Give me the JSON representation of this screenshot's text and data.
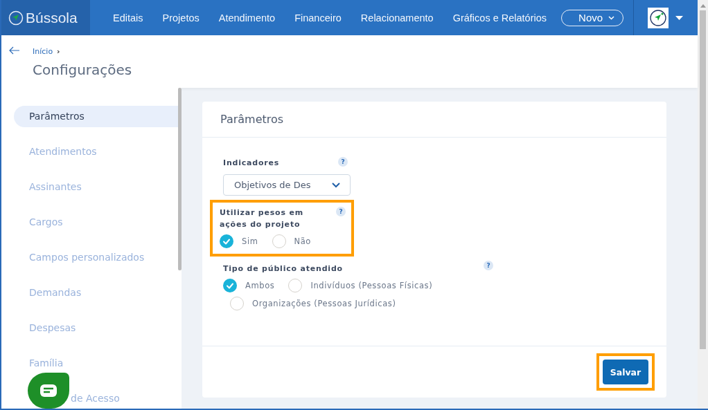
{
  "brand": {
    "name": "Bússola"
  },
  "nav": [
    {
      "label": "Editais"
    },
    {
      "label": "Projetos"
    },
    {
      "label": "Atendimento"
    },
    {
      "label": "Financeiro"
    },
    {
      "label": "Relacionamento"
    },
    {
      "label": "Gráficos e Relatórios"
    }
  ],
  "new_button": {
    "label": "Novo"
  },
  "breadcrumb": [
    {
      "label": "Início",
      "separator": "›"
    }
  ],
  "page_title": "Configurações",
  "sidebar": {
    "items": [
      {
        "label": "Parâmetros",
        "selected": true,
        "covered_start": false
      },
      {
        "label": "Atendimentos",
        "selected": false,
        "covered_start": false
      },
      {
        "label": "Assinantes",
        "selected": false,
        "covered_start": false
      },
      {
        "label": "Cargos",
        "selected": false,
        "covered_start": false
      },
      {
        "label": "Campos personalizados",
        "selected": false,
        "covered_start": false
      },
      {
        "label": "Demandas",
        "selected": false,
        "covered_start": false
      },
      {
        "label": "Despesas",
        "selected": false,
        "covered_start": false
      },
      {
        "label": "Família",
        "selected": false,
        "covered_start": false
      },
      {
        "label": "de Acesso",
        "selected": false,
        "covered_start": true
      }
    ]
  },
  "card": {
    "title": "Parâmetros",
    "fields": [
      {
        "kind": "select",
        "label": "Indicadores",
        "help": "?",
        "value": "Objetivos de Des",
        "highlighted": false
      },
      {
        "kind": "radio",
        "label": "Utilizar pesos em ações do projeto",
        "help": "?",
        "highlighted": true,
        "options": [
          {
            "label": "Sim",
            "selected": true
          },
          {
            "label": "Não",
            "selected": false
          }
        ]
      },
      {
        "kind": "radio",
        "label": "Tipo de público atendido",
        "help": "?",
        "highlighted": false,
        "options": [
          {
            "label": "Ambos",
            "selected": true
          },
          {
            "label": "Indivíduos (Pessoas Físicas)",
            "selected": false
          },
          {
            "label": "Organizações (Pessoas Jurídicas)",
            "selected": false
          }
        ]
      }
    ],
    "save_button": {
      "label": "Salvar",
      "highlighted": true
    }
  }
}
